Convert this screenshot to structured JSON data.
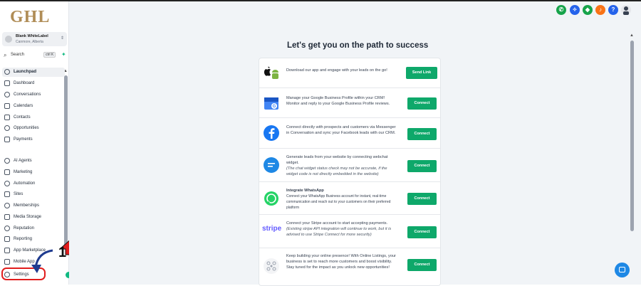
{
  "sidebar": {
    "logo": "GHL",
    "account": {
      "name": "Blank WhiteLabel",
      "location": "Canmore, Alberta"
    },
    "search": {
      "label": "Search",
      "shortcut": "ctrl K"
    },
    "items": [
      {
        "label": "Launchpad",
        "icon": "rocket-icon",
        "active": true
      },
      {
        "label": "Dashboard",
        "icon": "dashboard-icon"
      },
      {
        "label": "Conversations",
        "icon": "chat-icon"
      },
      {
        "label": "Calendars",
        "icon": "calendar-icon"
      },
      {
        "label": "Contacts",
        "icon": "contacts-icon"
      },
      {
        "label": "Opportunities",
        "icon": "opportunities-icon"
      },
      {
        "label": "Payments",
        "icon": "payments-icon"
      },
      {
        "label": "AI Agents",
        "icon": "ai-icon"
      },
      {
        "label": "Marketing",
        "icon": "send-icon"
      },
      {
        "label": "Automation",
        "icon": "automation-icon"
      },
      {
        "label": "Sites",
        "icon": "sites-icon"
      },
      {
        "label": "Memberships",
        "icon": "memberships-icon"
      },
      {
        "label": "Media Storage",
        "icon": "media-icon"
      },
      {
        "label": "Reputation",
        "icon": "reputation-icon"
      },
      {
        "label": "Reporting",
        "icon": "reporting-icon"
      },
      {
        "label": "App Marketplace",
        "icon": "marketplace-icon"
      },
      {
        "label": "Mobile App",
        "icon": "mobile-icon"
      },
      {
        "label": "Settings",
        "icon": "gear-icon"
      }
    ]
  },
  "annotation": {
    "step_number": "1"
  },
  "main": {
    "heading": "Let's get you on the path to success",
    "rows": [
      {
        "icon": "app-store-icon",
        "text": "Download our app and engage with your leads on the go!",
        "note": "",
        "button": "Send Link"
      },
      {
        "icon": "google-business-icon",
        "text": "Manage your Google Business Profile within your CRM! Monitor and reply to your Google Business Profile reviews.",
        "note": "",
        "button": "Connect"
      },
      {
        "icon": "facebook-icon",
        "text": "Connect directly with prospects and customers via Messenger in Conversation and sync your Facebook leads with our CRM.",
        "note": "",
        "button": "Connect"
      },
      {
        "icon": "webchat-icon",
        "text": "Generate leads from your website by connecting webchat widget.",
        "note": "(The chat widget status check may not be accurate, if the widget code is not directly embedded in the website)",
        "button": "Connect"
      },
      {
        "icon": "whatsapp-icon",
        "text": "Integrate WhatsApp",
        "note": "Connect your WhatsApp Business account for instant, real-time communication and reach out to your customers on their preferred platform",
        "button": "Connect"
      },
      {
        "icon": "stripe-icon",
        "text": "Connect your Stripe account to start accepting payments.",
        "note": "(Existing stripe API integration will continue to work, but it is advised to use Stripe Connect for more security)",
        "button": "Connect"
      },
      {
        "icon": "listings-icon",
        "text": "Keep building your online presence! With Online Listings, your business is set to reach more customers and boost visibility. Stay tuned for the impact as you unlock new opportunities!",
        "note": "",
        "button": "Connect"
      }
    ],
    "stripe_word": "stripe"
  },
  "topbar_icons": [
    "phone-icon",
    "sparkle-icon",
    "megaphone-icon",
    "bell-icon",
    "help-icon",
    "avatar"
  ],
  "colors": {
    "accent_green": "#0ea86a",
    "brand_gold": "#b08d57",
    "highlight_red": "#e11d1d"
  }
}
